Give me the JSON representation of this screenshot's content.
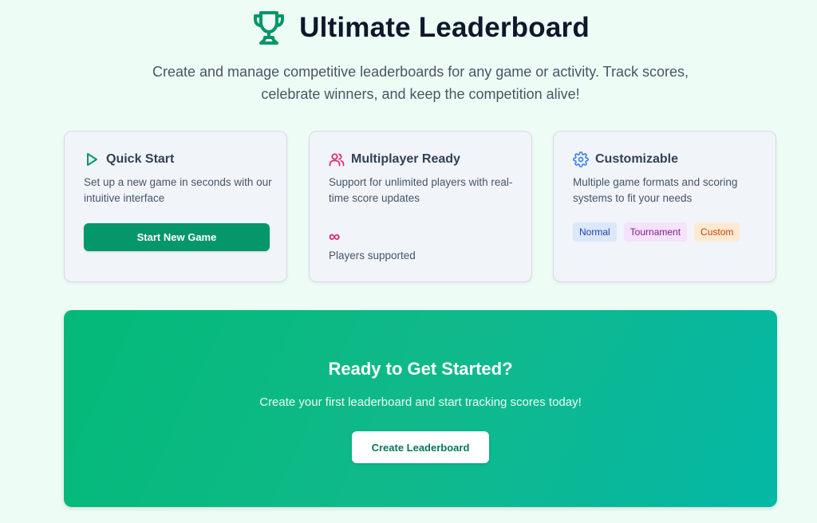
{
  "header": {
    "icon": "trophy-icon",
    "title": "Ultimate Leaderboard",
    "subtitle_line1": "Create and manage competitive leaderboards for any game or activity. Track scores,",
    "subtitle_line2": "celebrate winners, and keep the competition alive!"
  },
  "cards": {
    "quick_start": {
      "icon": "play-icon",
      "title": "Quick Start",
      "description": "Set up a new game in seconds with our intuitive interface",
      "button_label": "Start New Game"
    },
    "multiplayer": {
      "icon": "users-icon",
      "title": "Multiplayer Ready",
      "description": "Support for unlimited players with real-time score updates",
      "stat_value": "∞",
      "stat_label": "Players supported"
    },
    "customizable": {
      "icon": "gear-icon",
      "title": "Customizable",
      "description": "Multiple game formats and scoring systems to fit your needs",
      "badges": [
        "Normal",
        "Tournament",
        "Custom"
      ]
    }
  },
  "cta": {
    "title": "Ready to Get Started?",
    "description": "Create your first leaderboard and start tracking scores today!",
    "button_label": "Create Leaderboard"
  },
  "colors": {
    "accent_green": "#059669",
    "pink": "#db2777",
    "blue_icon": "#3b82f6",
    "background": "#eefcf6"
  }
}
